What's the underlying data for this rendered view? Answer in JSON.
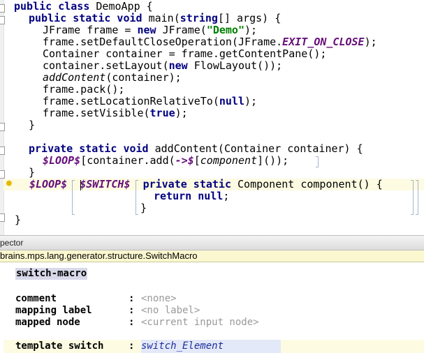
{
  "editor": {
    "l1": {
      "kw": "public class",
      "rest": " DemoApp {"
    },
    "l2": {
      "kw": "public static void",
      "rest": " main(",
      "kw2": "string",
      "rest2": "[] args) {"
    },
    "l3": {
      "a": "JFrame frame = ",
      "kw": "new",
      "b": " JFrame(",
      "str": "\"Demo\"",
      "c": ");"
    },
    "l4": {
      "a": "frame.setDefaultCloseOperation(JFrame.",
      "fld": "EXIT_ON_CLOSE",
      "b": ");"
    },
    "l5": "Container container = frame.getContentPane();",
    "l6": {
      "a": "container.setLayout(",
      "kw": "new",
      "b": " FlowLayout());"
    },
    "l7": {
      "ital": "addContent",
      "b": "(container);"
    },
    "l8": "frame.pack();",
    "l9": {
      "a": "frame.setLocationRelativeTo(",
      "kw": "null",
      "b": ");"
    },
    "l10": {
      "a": "frame.setVisible(",
      "kw": "true",
      "b": ");"
    },
    "l11": "}",
    "l13": {
      "kw": "private static void",
      "b": " addContent(Container container) {"
    },
    "l14": {
      "m1": "$LOOP$",
      "a": "[container.add(",
      "m2": "->$",
      "b": "[",
      "ref": "component",
      "c": "]());"
    },
    "l15": "}",
    "l16": {
      "m1": "$LOOP$",
      "m2": "$SWITCH$",
      "kw": "private static",
      "b": " Component component() {"
    },
    "l17": {
      "kw": "return",
      "kw2": "null",
      "b": ";"
    },
    "l18": "}",
    "l19": "}"
  },
  "inspector": {
    "header": "pector",
    "path": "brains.mps.lang.generator.structure.SwitchMacro",
    "concept": "switch-macro",
    "props": [
      {
        "label": "comment",
        "colon": ":",
        "value": "<none>"
      },
      {
        "label": "mapping label",
        "colon": ":",
        "value": "<no label>"
      },
      {
        "label": "mapped node",
        "colon": ":",
        "value": "<current input node>"
      }
    ],
    "template_switch": {
      "label": "template switch",
      "colon": ":",
      "value": "switch_Element"
    }
  },
  "colors": {
    "keyword": "#000080",
    "string": "#008000",
    "macro": "#660e7a",
    "highlight_line": "#fdfbe2",
    "path_bar": "#fbf7cf"
  },
  "icons": [
    "lightbulb-icon",
    "fold-marker-icon"
  ]
}
